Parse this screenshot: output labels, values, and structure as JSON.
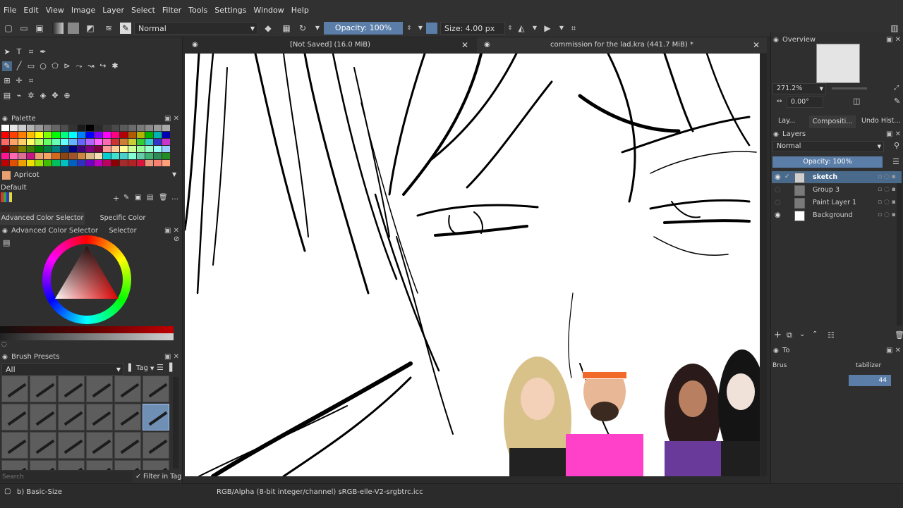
{
  "menubar": {
    "items": [
      "File",
      "Edit",
      "View",
      "Image",
      "Layer",
      "Select",
      "Filter",
      "Tools",
      "Settings",
      "Window",
      "Help"
    ]
  },
  "toolbar": {
    "blend_mode": "Normal",
    "opacity_label": "Opacity: 100%",
    "size_label": "Size: 4.00 px",
    "icons": [
      "new-document-icon",
      "open-document-icon",
      "save-icon",
      "gradient-icon",
      "pattern-icon",
      "colors-icon",
      "brush-settings-icon",
      "brush-preset-icon",
      "eraser-icon",
      "alpha-lock-icon",
      "reload-icon",
      "mirror-icon",
      "wrap-icon",
      "crop-icon"
    ]
  },
  "tabs": [
    {
      "label": "[Not Saved]  (16.0 MiB)"
    },
    {
      "label": "commission for the lad.kra  (441.7 MiB) *"
    }
  ],
  "palette": {
    "title": "Palette",
    "current_color_name": "Apricot",
    "current_color": "#e8a070",
    "group": "Default",
    "colors": [
      [
        "#ffffff",
        "#e6e6e6",
        "#cccccc",
        "#b3b3b3",
        "#999999",
        "#808080",
        "#666666",
        "#4d4d4d",
        "#333333",
        "#1a1a1a",
        "#000000",
        "#2a2a2a",
        "#3a3a3a",
        "#4a4a4a",
        "#5a5a5a",
        "#6a6a6a",
        "#7a7a7a",
        "#8a8a8a",
        "#9a9a9a",
        "#aaaaaa"
      ],
      [
        "#ff0000",
        "#ff4000",
        "#ff8000",
        "#ffbf00",
        "#ffff00",
        "#80ff00",
        "#00ff00",
        "#00ff80",
        "#00ffff",
        "#0080ff",
        "#0000ff",
        "#8000ff",
        "#ff00ff",
        "#ff0080",
        "#b30000",
        "#b35900",
        "#b3b300",
        "#00b300",
        "#00b3b3",
        "#0000b3"
      ],
      [
        "#ff6666",
        "#ffa366",
        "#ffd166",
        "#ffff66",
        "#b3ff66",
        "#66ff66",
        "#66ffb3",
        "#66ffff",
        "#66b3ff",
        "#6666ff",
        "#b366ff",
        "#ff66ff",
        "#ff66b3",
        "#cc3333",
        "#cc8033",
        "#cccc33",
        "#33cc33",
        "#33cccc",
        "#3333cc",
        "#cc33cc"
      ],
      [
        "#800000",
        "#804000",
        "#808000",
        "#408000",
        "#008000",
        "#008040",
        "#008080",
        "#004080",
        "#000080",
        "#400080",
        "#800080",
        "#800040",
        "#ff9999",
        "#ffcc99",
        "#ffff99",
        "#ccff99",
        "#99ff99",
        "#99ffcc",
        "#99ffff",
        "#99ccff"
      ],
      [
        "#ff1493",
        "#ff69b4",
        "#db7093",
        "#c71585",
        "#e8a070",
        "#f4a460",
        "#d2691e",
        "#8b4513",
        "#a0522d",
        "#cd853f",
        "#deb887",
        "#f5deb3",
        "#00ced1",
        "#40e0d0",
        "#48d1cc",
        "#7fffd4",
        "#66cdaa",
        "#3cb371",
        "#2e8b57",
        "#228b22"
      ],
      [
        "#c00000",
        "#e05000",
        "#f0a000",
        "#f0e000",
        "#a0e000",
        "#40c000",
        "#00c060",
        "#00c0c0",
        "#0060c0",
        "#3030c0",
        "#7000c0",
        "#c000c0",
        "#c00060",
        "#8b0000",
        "#a52a2a",
        "#b22222",
        "#dc143c",
        "#e9967a",
        "#fa8072",
        "#ffa07a"
      ]
    ]
  },
  "color_selectors": {
    "tab_advanced": "Advanced Color Selector",
    "tab_specific": "Specific Color Selector",
    "panel_title": "Advanced Color Selector"
  },
  "brush_presets": {
    "title": "Brush Presets",
    "filter": "All",
    "tag_label": "Tag",
    "search_placeholder": "Search",
    "filter_in_tag": "Filter in Tag"
  },
  "status": {
    "brush_name": "b) Basic-Size",
    "color_space": "RGB/Alpha (8-bit integer/channel)  sRGB-elle-V2-srgbtrc.icc"
  },
  "overview": {
    "title": "Overview",
    "zoom": "271.2%",
    "rotation": "0.00°"
  },
  "right_tabs": [
    "Lay...",
    "Compositi...",
    "Undo Hist..."
  ],
  "layers": {
    "title": "Layers",
    "blend_mode": "Normal",
    "opacity_label": "Opacity:  100%",
    "items": [
      {
        "name": "sketch",
        "visible": true,
        "selected": true,
        "thumb": "#cfcfcf"
      },
      {
        "name": "Group 3",
        "visible": false,
        "selected": false,
        "thumb": "#7a7a7a"
      },
      {
        "name": "Paint Layer 1",
        "visible": false,
        "selected": false,
        "thumb": "#7a7a7a"
      },
      {
        "name": "Background",
        "visible": true,
        "selected": false,
        "thumb": "#ffffff"
      }
    ]
  },
  "tool_options": {
    "title": "To",
    "brush_label": "Brus",
    "stabilizer_label": "tabilizer",
    "value": "44"
  },
  "colors": {
    "accent": "#5a7ea8",
    "layer_selected": "#4a6a8c"
  }
}
